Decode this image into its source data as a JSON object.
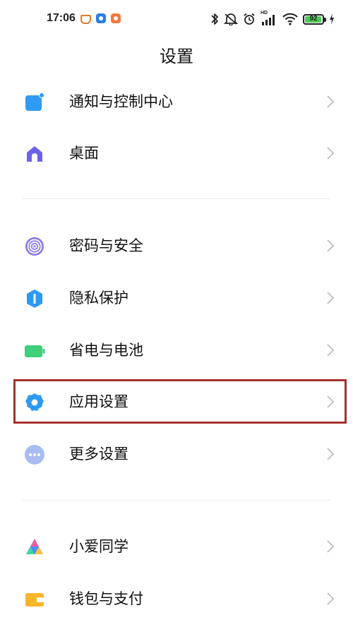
{
  "status_bar": {
    "time": "17:06",
    "battery_level": "92",
    "signal_tag": "HD",
    "icons": [
      "bluetooth-icon",
      "mute-icon",
      "alarm-icon",
      "signal-icon",
      "wifi-icon",
      "battery-icon",
      "charging-icon"
    ],
    "app_icons": [
      "notification-app-icon",
      "notification-app-icon-2",
      "notification-app-icon-3"
    ]
  },
  "header": {
    "title": "设置"
  },
  "menu": {
    "group1": [
      {
        "label": "通知与控制中心",
        "icon": "notification-control-icon",
        "color": "#2f9bf2"
      },
      {
        "label": "桌面",
        "icon": "home-icon",
        "color": "#6c63e9"
      }
    ],
    "group2": [
      {
        "label": "密码与安全",
        "icon": "fingerprint-icon",
        "color": "#7d6ae0"
      },
      {
        "label": "隐私保护",
        "icon": "privacy-shield-icon",
        "color": "#2d9af1"
      },
      {
        "label": "省电与电池",
        "icon": "battery-saver-icon",
        "color": "#3ed07a"
      },
      {
        "label": "应用设置",
        "icon": "app-settings-gear-icon",
        "color": "#2d9af1"
      },
      {
        "label": "更多设置",
        "icon": "more-settings-icon",
        "color": "#9fb3f0"
      }
    ],
    "group3": [
      {
        "label": "小爱同学",
        "icon": "xiaoai-icon",
        "color": "#4c8cf5"
      },
      {
        "label": "钱包与支付",
        "icon": "wallet-icon",
        "color": "#f7b52a"
      }
    ]
  },
  "highlight": {
    "target": "应用设置",
    "color": "#a8302c"
  }
}
